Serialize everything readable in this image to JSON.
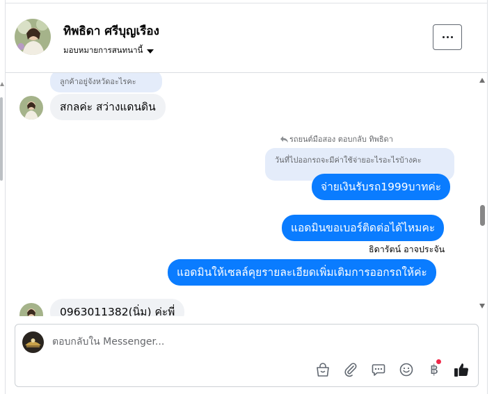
{
  "header": {
    "contact_name": "ทิพธิดา ศรีบุญเรือง",
    "assign_label": "มอบหมายการสนทนานี้"
  },
  "messages": {
    "reply_ref_1": "ลูกค้าอยู่จังหวัดอะไรคะ",
    "incoming_1": "สกลค่ะ สว่างแดนดิน",
    "reply_meta": "รถยนต์มือสอง ตอบกลับ ทิพธิดา",
    "reply_ref_2": "วันที่ไปออกรถจะมีค่าใช้จ่ายอะไรอะไรบ้างคะ",
    "outgoing_1": "จ่ายเงินรับรถ1999บาทค่ะ",
    "outgoing_2": "แอดมินขอเบอร์ติดต่อได้ไหมคะ",
    "sender_name": "ธิดารัตน์ อาจประจัน",
    "outgoing_3": "แอดมินให้เซลล์คุยรายละเอียดเพิ่มเติมการออกรถให้ค่ะ",
    "incoming_2": "0963011382(นิ่ม) ค่ะพี่"
  },
  "composer": {
    "placeholder": "ตอบกลับใน Messenger...",
    "baht_symbol": "฿"
  },
  "colors": {
    "outgoing_bubble": "#0a7cff",
    "incoming_bubble": "#f0f2f5",
    "reply_ref_bubble": "#e4ecfa",
    "notification_dot": "#f02849"
  },
  "icons": [
    "more-icon",
    "chevron-down-icon",
    "reply-arrow-icon",
    "shopping-bag-icon",
    "attachment-icon",
    "saved-replies-icon",
    "emoji-icon",
    "baht-icon",
    "thumbs-up-icon"
  ]
}
